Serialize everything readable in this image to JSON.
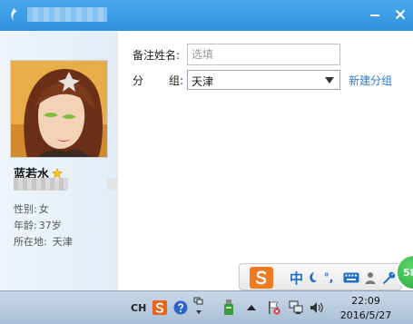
{
  "window": {
    "title_bar": {
      "minimize_icon": "minimize-icon",
      "close_icon": "close-icon"
    },
    "accent_color": "#2f92de"
  },
  "profile": {
    "nickname": "蓝若水",
    "gender_label": "性别:",
    "gender_value": "女",
    "age_label": "年龄:",
    "age_value": "37岁",
    "location_label": "所在地:",
    "location_value": "天津"
  },
  "form": {
    "remark_label": "备注姓名:",
    "remark_placeholder": "选填",
    "group_label_1": "分",
    "group_label_2": "组:",
    "group_value": "天津",
    "new_group_link": "新建分组"
  },
  "ime_bar": {
    "lang": "中",
    "punct": "°,",
    "badge": "58"
  },
  "taskbar": {
    "lang_indicator": "CH",
    "time": "22:09",
    "date": "2016/5/27"
  }
}
